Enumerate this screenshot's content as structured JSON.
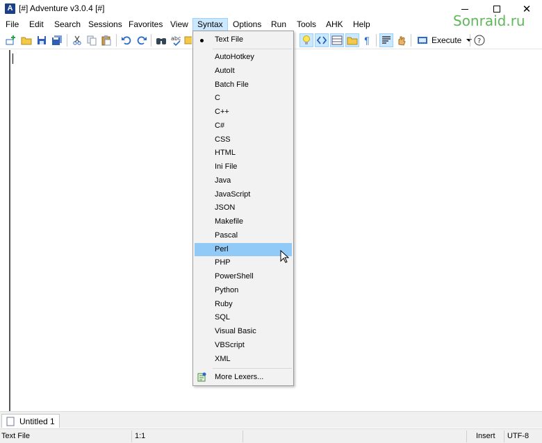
{
  "window": {
    "title": "[#] Adventure v3.0.4 [#]",
    "app_icon_letter": "A",
    "close_glyph": "✕"
  },
  "watermark": "Sonraid.ru",
  "menu": {
    "items": [
      "File",
      "Edit",
      "Search",
      "Sessions",
      "Favorites",
      "View",
      "Syntax",
      "Options",
      "Run",
      "Tools",
      "AHK",
      "Help"
    ],
    "active": "Syntax"
  },
  "toolbar": {
    "icons": [
      "new-file-icon",
      "open-folder-icon",
      "save-icon",
      "save-all-icon",
      "cut-icon",
      "copy-icon",
      "paste-icon",
      "undo-icon",
      "redo-icon",
      "find-icon",
      "spellcheck-icon",
      "bookmark-icon",
      "lightbulb-icon",
      "code-toggle-icon",
      "split-view-icon",
      "folder-icon",
      "pilcrow-icon",
      "word-wrap-icon",
      "hand-icon",
      "help-icon"
    ],
    "execute_label": "Execute",
    "help_glyph": "?",
    "pilcrow_glyph": "¶"
  },
  "syntax_menu": {
    "checked": "Text File",
    "top_item": "Text File",
    "languages": [
      "AutoHotkey",
      "AutoIt",
      "Batch File",
      "C",
      "C++",
      "C#",
      "CSS",
      "HTML",
      "Ini File",
      "Java",
      "JavaScript",
      "JSON",
      "Makefile",
      "Pascal",
      "Perl",
      "PHP",
      "PowerShell",
      "Python",
      "Ruby",
      "SQL",
      "Visual Basic",
      "VBScript",
      "XML"
    ],
    "highlighted": "Perl",
    "more": "More Lexers..."
  },
  "tabs": [
    {
      "label": "Untitled 1"
    }
  ],
  "status": {
    "syntax": "Text File",
    "position": "1:1",
    "mode": "Insert",
    "encoding": "UTF-8"
  },
  "colors": {
    "menu_active_bg": "#cce8ff",
    "item_highlight": "#91c9f7",
    "watermark": "#5fb85a",
    "app_icon": "#1d3f8a"
  }
}
